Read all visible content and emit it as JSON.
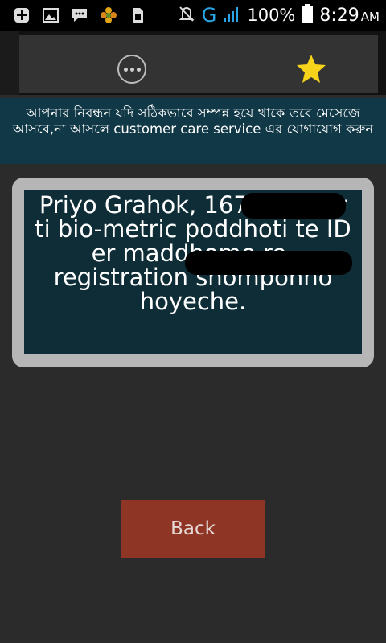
{
  "status_bar": {
    "left_icons": [
      "add-icon",
      "image-icon",
      "chat-icon",
      "flower-icon",
      "sim-card-icon"
    ],
    "network_type": "G",
    "battery_percent": "100%",
    "time": "8:29",
    "ampm": "AM"
  },
  "action_bar": {
    "icons": [
      "more-options-icon",
      "star-icon"
    ]
  },
  "banner": {
    "text": "আপনার নিবন্ধন যদি সঠিকভাবে সম্পন্ন হয়ে থাকে তবে মেসেজে আসবে,না আসলে customer care service এর যোগাযোগ করুন"
  },
  "message": {
    "text": "Priyo Grahok, 167 number ti bio-metric poddhoti te ID er maddhome re-registration shomponno hoyeche."
  },
  "back_button": {
    "label": "Back"
  },
  "colors": {
    "background": "#2b2b2b",
    "banner": "#113847",
    "message_box": "#0f2d36",
    "frame": "#b6b6b6",
    "button": "#8f3525",
    "star": "#f7d21b"
  }
}
